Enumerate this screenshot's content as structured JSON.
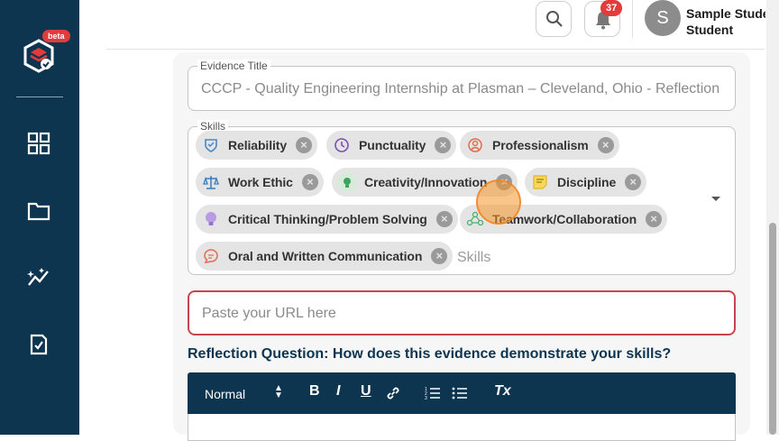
{
  "sidebar": {
    "beta_badge": "beta",
    "nav": [
      {
        "icon": "dashboard-grid-icon"
      },
      {
        "icon": "folder-icon"
      },
      {
        "icon": "analytics-icon"
      },
      {
        "icon": "checklist-icon"
      }
    ]
  },
  "header": {
    "notification_count": "37",
    "avatar_initial": "S",
    "user_name": "Sample Student",
    "user_role": "Student"
  },
  "form": {
    "evidence_title_label": "Evidence Title",
    "evidence_title_value": "CCCP - Quality Engineering Internship at Plasman – Cleveland, Ohio - Reflection",
    "skills_label": "Skills",
    "skills_placeholder": "Skills",
    "skills": [
      {
        "label": "Reliability",
        "icon": "shield-badge-icon",
        "color": "#4a86c5"
      },
      {
        "label": "Punctuality",
        "icon": "clock-icon",
        "color": "#7a4fb5"
      },
      {
        "label": "Professionalism",
        "icon": "person-target-icon",
        "color": "#e36a4f"
      },
      {
        "label": "Work Ethic",
        "icon": "scales-icon",
        "color": "#3a7bbf"
      },
      {
        "label": "Creativity/Innovation",
        "icon": "lightbulb-head-icon",
        "color": "#3fa35f"
      },
      {
        "label": "Discipline",
        "icon": "sticky-note-icon",
        "color": "#e3b52a"
      },
      {
        "label": "Critical Thinking/Problem Solving",
        "icon": "lightbulb-icon",
        "color": "#9b6fd6"
      },
      {
        "label": "Teamwork/Collaboration",
        "icon": "team-network-icon",
        "color": "#4caf6a"
      },
      {
        "label": "Oral and Written Communication",
        "icon": "speech-bubble-icon",
        "color": "#e36a4f"
      }
    ],
    "url_placeholder": "Paste your URL here",
    "reflection_question": "Reflection Question: How does this evidence demonstrate your skills?",
    "toolbar": {
      "format_value": "Normal",
      "bold": "B",
      "italic": "I",
      "underline": "U",
      "clear": "Tx"
    }
  }
}
